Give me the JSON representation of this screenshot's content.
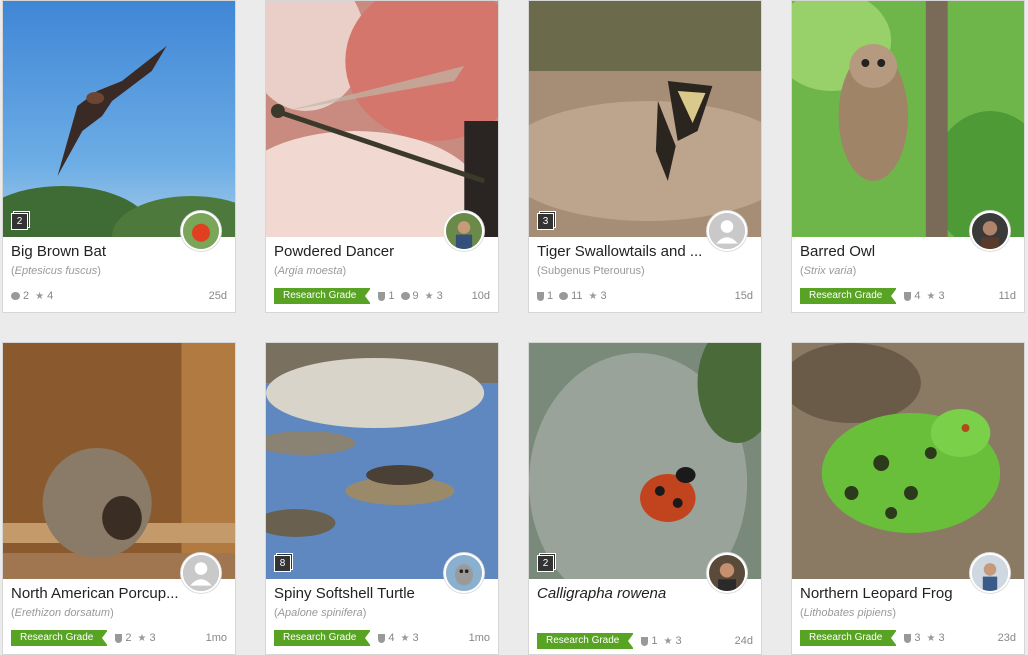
{
  "cards": [
    {
      "title": "Big Brown Bat",
      "sci": "Eptesicus fuscus",
      "sci_italic": true,
      "photos": "2",
      "research": false,
      "ids": null,
      "comments": "2",
      "faves": "4",
      "age": "25d"
    },
    {
      "title": "Powdered Dancer",
      "sci": "Argia moesta",
      "sci_italic": true,
      "photos": null,
      "research": true,
      "ids": "1",
      "comments": "9",
      "faves": "3",
      "age": "10d"
    },
    {
      "title": "Tiger Swallowtails and ...",
      "sci": "Subgenus Pterourus",
      "sci_italic": false,
      "photos": "3",
      "research": false,
      "ids": "1",
      "comments": "11",
      "faves": "3",
      "age": "15d"
    },
    {
      "title": "Barred Owl",
      "sci": "Strix varia",
      "sci_italic": true,
      "photos": null,
      "research": true,
      "ids": "4",
      "comments": null,
      "faves": "3",
      "age": "11d"
    },
    {
      "title": "North American Porcup...",
      "sci": "Erethizon dorsatum",
      "sci_italic": true,
      "photos": null,
      "research": true,
      "ids": "2",
      "comments": null,
      "faves": "3",
      "age": "1mo"
    },
    {
      "title": "Spiny Softshell Turtle",
      "sci": "Apalone spinifera",
      "sci_italic": true,
      "photos": "8",
      "research": true,
      "ids": "4",
      "comments": null,
      "faves": "3",
      "age": "1mo"
    },
    {
      "title": "Calligrapha rowena",
      "sci": "",
      "sci_italic": true,
      "photos": "2",
      "research": true,
      "ids": "1",
      "comments": null,
      "faves": "3",
      "age": "24d"
    },
    {
      "title": "Northern Leopard Frog",
      "sci": "Lithobates pipiens",
      "sci_italic": true,
      "photos": null,
      "research": true,
      "ids": "3",
      "comments": null,
      "faves": "3",
      "age": "23d"
    }
  ],
  "labels": {
    "research_grade": "Research Grade",
    "paren_open": "(",
    "paren_close": ")"
  }
}
